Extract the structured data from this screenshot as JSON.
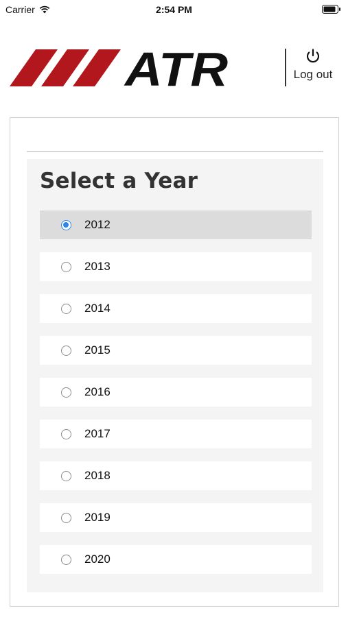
{
  "status_bar": {
    "carrier": "Carrier",
    "time": "2:54 PM"
  },
  "header": {
    "brand": "ATR",
    "logout_label": "Log out",
    "brand_colors": {
      "stripe": "#b1171d",
      "text": "#111111"
    }
  },
  "year_selector": {
    "title": "Select a Year",
    "selected": "2012",
    "accent_color": "#2f86e6",
    "options": [
      {
        "label": "2012"
      },
      {
        "label": "2013"
      },
      {
        "label": "2014"
      },
      {
        "label": "2015"
      },
      {
        "label": "2016"
      },
      {
        "label": "2017"
      },
      {
        "label": "2018"
      },
      {
        "label": "2019"
      },
      {
        "label": "2020"
      }
    ]
  }
}
